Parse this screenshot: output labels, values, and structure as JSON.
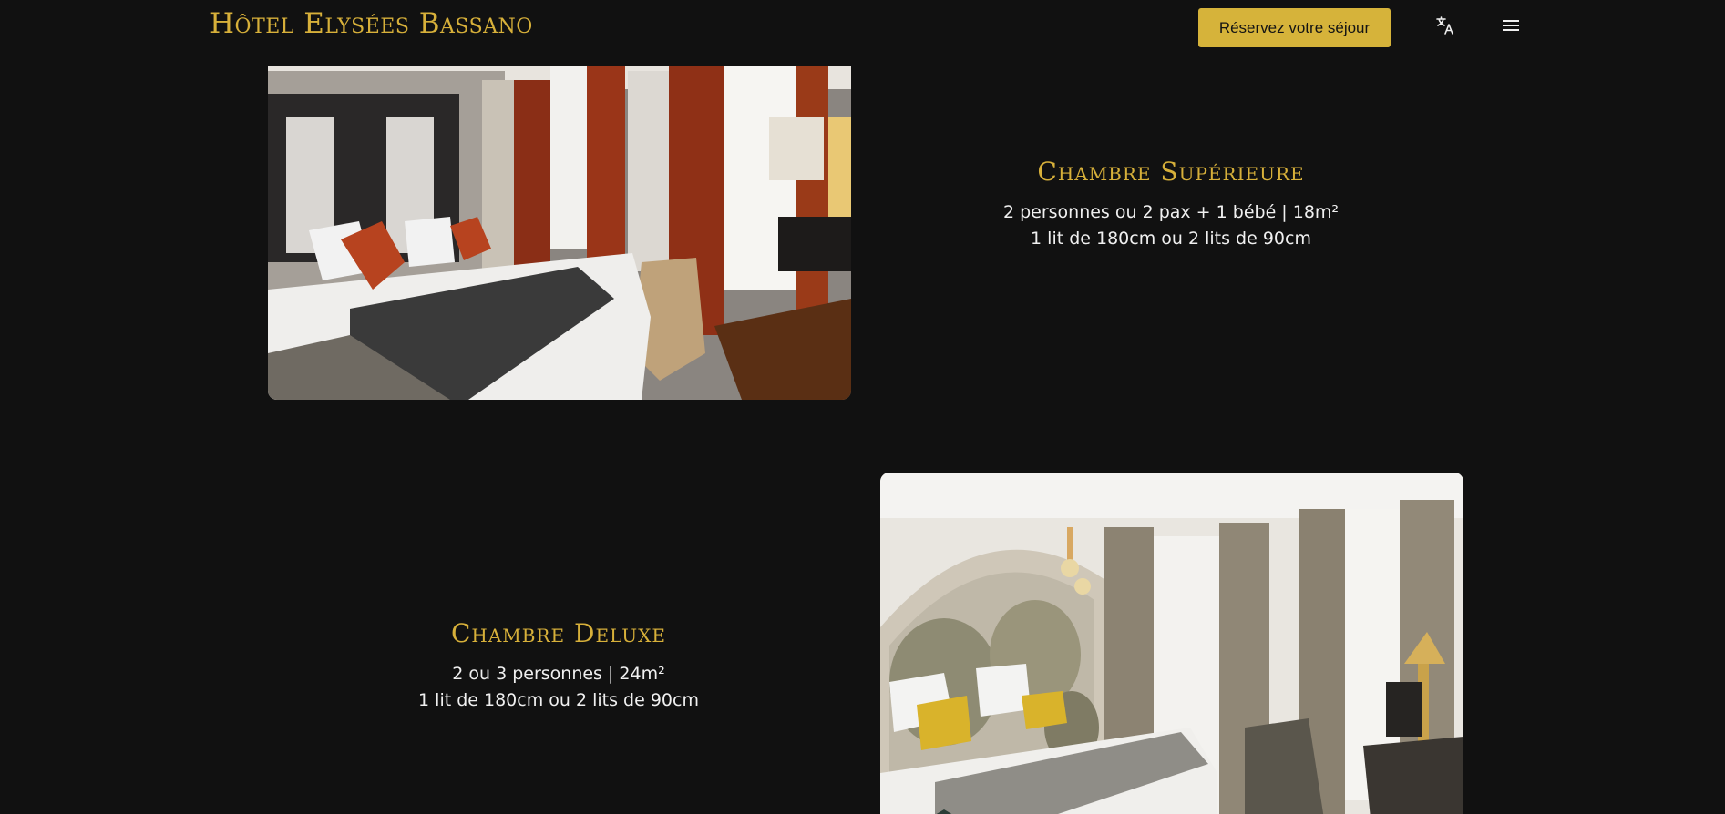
{
  "header": {
    "brand": "Hôtel Elysées Bassano",
    "book_label": "Réservez votre séjour",
    "language_icon": "translate-icon",
    "menu_icon": "hamburger-menu-icon"
  },
  "colors": {
    "background": "#111111",
    "accent_gold": "#d6b33a",
    "text": "#f0f0f0"
  },
  "rooms": [
    {
      "title": "Chambre Supérieure",
      "line1": "2 personnes ou 2 pax + 1 bébé | 18m²",
      "line2": "1 lit de 180cm ou 2 lits de 90cm",
      "photo": "bedroom-photo"
    },
    {
      "title": "Chambre Deluxe",
      "line1": "2 ou 3 personnes | 24m²",
      "line2": "1 lit de 180cm ou 2 lits de 90cm",
      "photo": "bedroom-photo"
    }
  ]
}
